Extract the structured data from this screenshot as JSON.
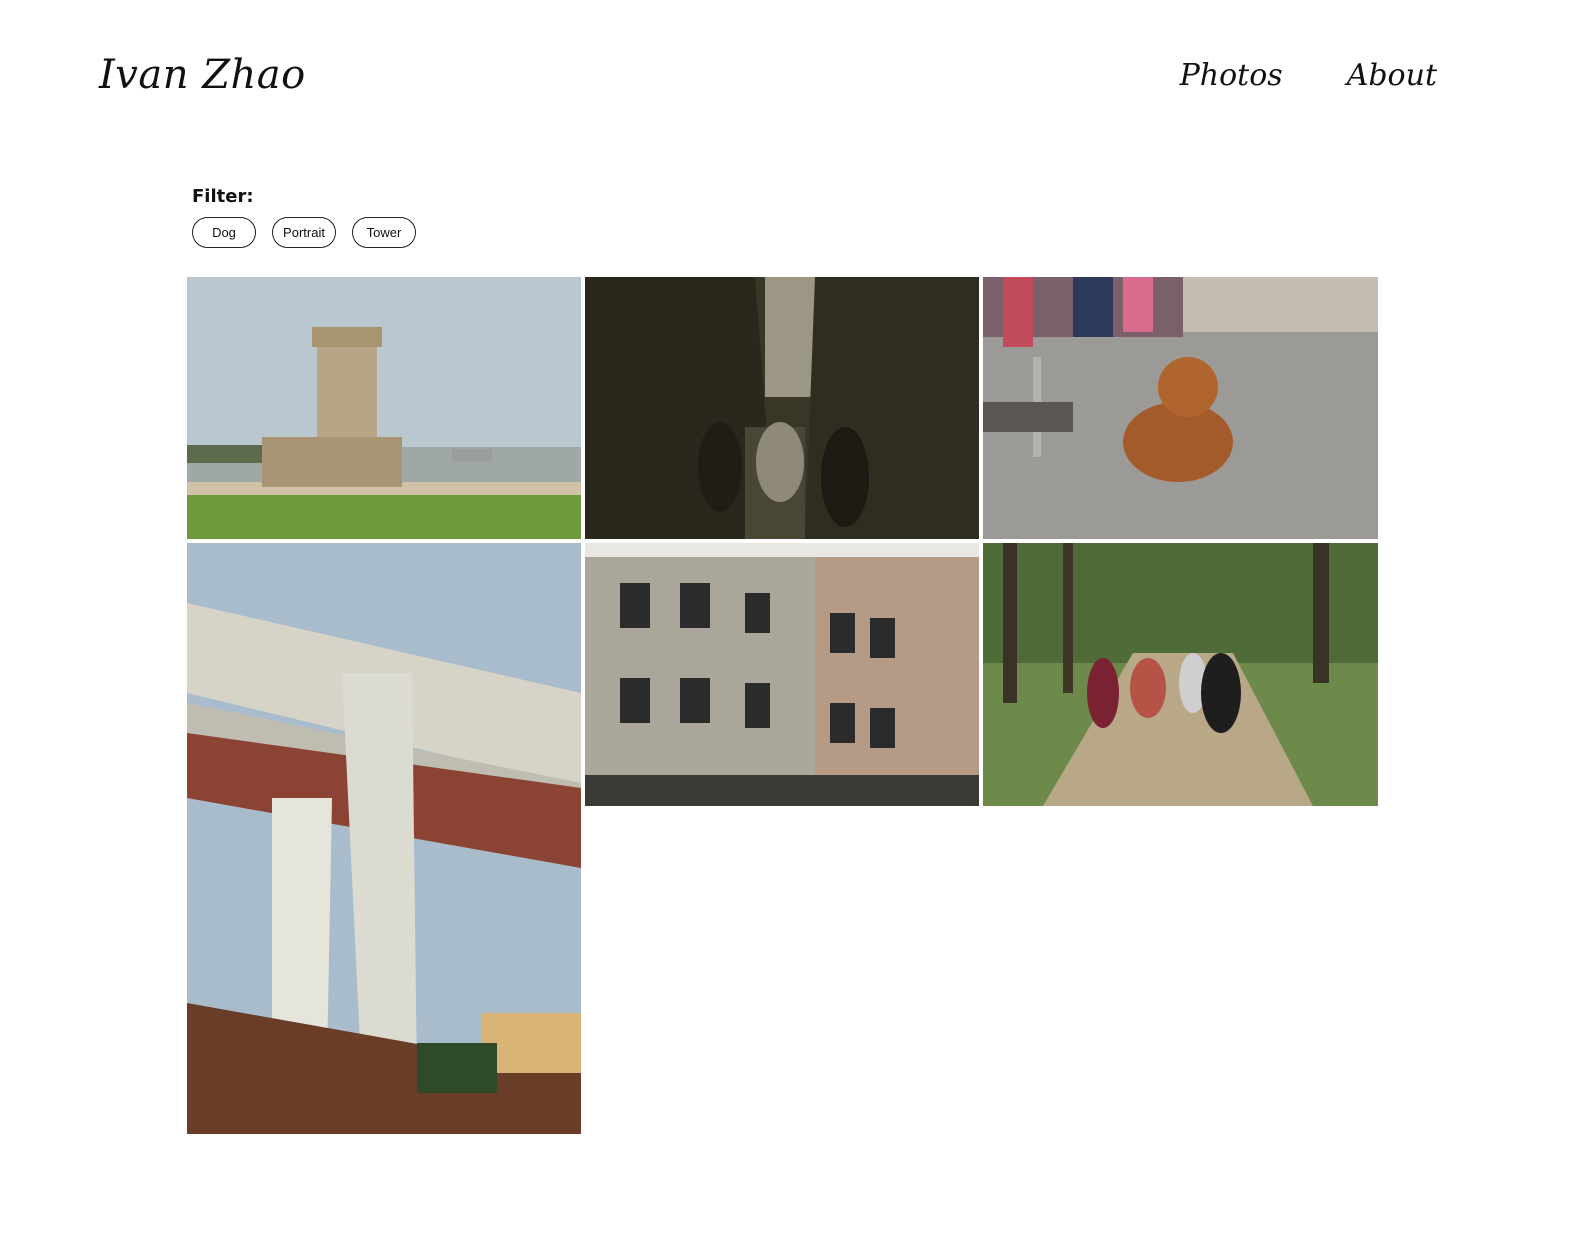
{
  "header": {
    "site_title": "Ivan Zhao",
    "nav": [
      {
        "label": "Photos"
      },
      {
        "label": "About"
      }
    ]
  },
  "filter": {
    "label": "Filter:",
    "tags": [
      "Dog",
      "Portrait",
      "Tower"
    ]
  },
  "gallery": {
    "photos": [
      {
        "subject": "tower-by-water"
      },
      {
        "subject": "narrow-alley-people"
      },
      {
        "subject": "dog-lying-on-street"
      },
      {
        "subject": "bridge-underside"
      },
      {
        "subject": "tiled-building-facade"
      },
      {
        "subject": "friends-in-forest"
      }
    ]
  }
}
